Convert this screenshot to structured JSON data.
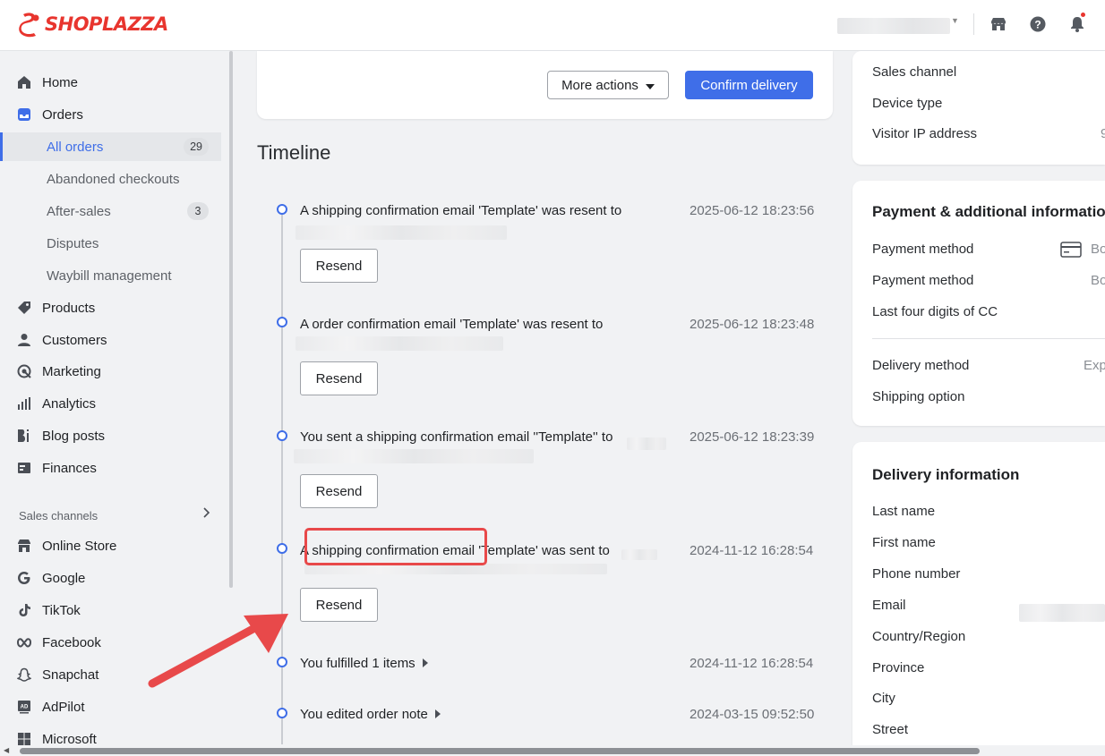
{
  "brand": {
    "name": "SHOPLAZZA",
    "color": "#e8352e"
  },
  "colors": {
    "accent": "#3f6ee8",
    "highlight": "#e8494a"
  },
  "topbar": {
    "icons": [
      "store-icon",
      "help-icon",
      "bell-icon"
    ]
  },
  "sidebar": {
    "items": [
      {
        "label": "Home",
        "icon": "home-icon"
      },
      {
        "label": "Orders",
        "icon": "orders-icon"
      },
      {
        "label": "Products",
        "icon": "tag-icon"
      },
      {
        "label": "Customers",
        "icon": "person-icon"
      },
      {
        "label": "Marketing",
        "icon": "target-icon"
      },
      {
        "label": "Analytics",
        "icon": "bar-chart-icon"
      },
      {
        "label": "Blog posts",
        "icon": "blog-icon"
      },
      {
        "label": "Finances",
        "icon": "finance-icon"
      }
    ],
    "orders_sub": [
      {
        "label": "All orders",
        "badge": "29"
      },
      {
        "label": "Abandoned checkouts"
      },
      {
        "label": "After-sales",
        "badge": "3"
      },
      {
        "label": "Disputes"
      },
      {
        "label": "Waybill management"
      }
    ],
    "sales_channels_label": "Sales channels",
    "channels": [
      {
        "label": "Online Store",
        "icon": "store-icon"
      },
      {
        "label": "Google",
        "icon": "google-icon"
      },
      {
        "label": "TikTok",
        "icon": "tiktok-icon"
      },
      {
        "label": "Facebook",
        "icon": "meta-icon"
      },
      {
        "label": "Snapchat",
        "icon": "snapchat-icon"
      },
      {
        "label": "AdPilot",
        "icon": "adpilot-icon"
      },
      {
        "label": "Microsoft",
        "icon": "microsoft-icon"
      }
    ]
  },
  "main": {
    "more_actions": "More actions",
    "confirm_delivery": "Confirm delivery",
    "timeline_title": "Timeline",
    "resend_label": "Resend",
    "events": [
      {
        "text": "A shipping confirmation email 'Template' was resent to",
        "time": "2025-06-12 18:23:56"
      },
      {
        "text": "A order confirmation email 'Template' was resent to",
        "time": "2025-06-12 18:23:48"
      },
      {
        "text": "You sent a shipping confirmation email ''Template'' to",
        "time": "2025-06-12 18:23:39"
      },
      {
        "text": "A shipping confirmation email 'Template' was sent to",
        "time": "2024-11-12 16:28:54"
      },
      {
        "text": "You fulfilled 1 items",
        "time": "2024-11-12 16:28:54"
      },
      {
        "text": "You edited order note",
        "time": "2024-03-15 09:52:50"
      }
    ]
  },
  "right": {
    "order_info": [
      {
        "label": "Sales channel"
      },
      {
        "label": "Device type"
      },
      {
        "label": "Visitor IP address",
        "value": "9"
      }
    ],
    "payment_heading": "Payment & additional information",
    "payment": [
      {
        "label": "Payment method",
        "value": "Bo"
      },
      {
        "label": "Payment method",
        "value": "Bo"
      },
      {
        "label": "Last four digits of CC"
      },
      {
        "label": "Delivery method",
        "value": "Exp"
      },
      {
        "label": "Shipping option"
      }
    ],
    "delivery_heading": "Delivery information",
    "delivery": [
      {
        "label": "Last name"
      },
      {
        "label": "First name"
      },
      {
        "label": "Phone number"
      },
      {
        "label": "Email"
      },
      {
        "label": "Country/Region"
      },
      {
        "label": "Province"
      },
      {
        "label": "City"
      },
      {
        "label": "Street"
      }
    ]
  }
}
